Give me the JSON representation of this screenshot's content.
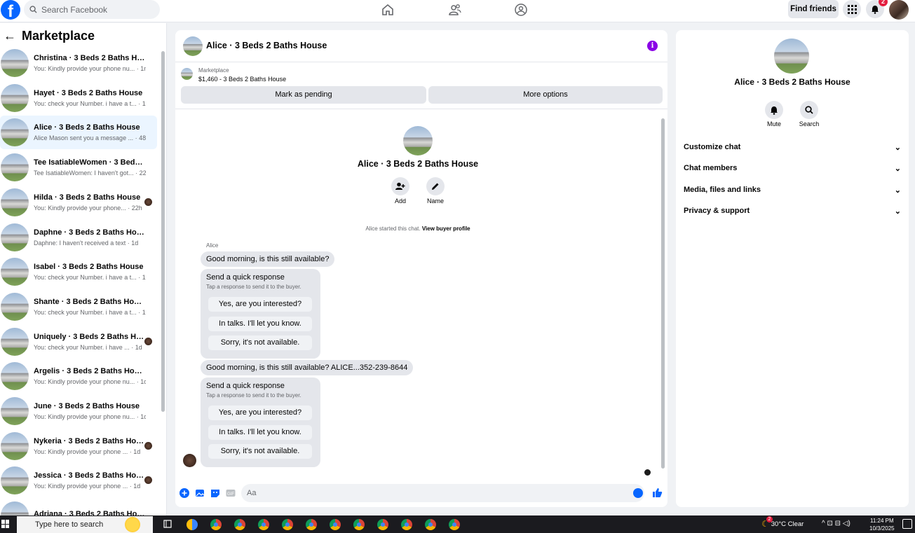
{
  "top": {
    "logo": "f",
    "search_placeholder": "Search Facebook",
    "find_friends": "Find friends",
    "notif_count": "2"
  },
  "sidebar": {
    "title": "Marketplace",
    "items": [
      {
        "name": "Christina · 3 Beds 2 Baths House",
        "preview": "You: Kindly provide your phone nu... · 1m"
      },
      {
        "name": "Hayet · 3 Beds 2 Baths House",
        "preview": "You: check your Number. i have a t... · 1m"
      },
      {
        "name": "Alice · 3 Beds 2 Baths House",
        "preview": "Alice Mason sent you a message ... · 48m"
      },
      {
        "name": "Tee IsatiableWomen · 3 Beds 2 B...",
        "preview": "Tee IsatiableWomen: I haven't got... · 22h"
      },
      {
        "name": "Hilda · 3 Beds 2 Baths House",
        "preview": "You: Kindly provide your phone... · 22h"
      },
      {
        "name": "Daphne · 3 Beds 2 Baths House",
        "preview": "Daphne: I haven't received a text · 1d"
      },
      {
        "name": "Isabel · 3 Beds 2 Baths House",
        "preview": "You: check your Number. i have a t... · 1d"
      },
      {
        "name": "Shante · 3 Beds 2 Baths House",
        "preview": "You: check your Number. i have a t... · 1d"
      },
      {
        "name": "Uniquely · 3 Beds 2 Baths Hou...",
        "preview": "You: check your Number. i have ... · 1d"
      },
      {
        "name": "Argelis · 3 Beds 2 Baths House",
        "preview": "You: Kindly provide your phone nu... · 1d"
      },
      {
        "name": "June · 3 Beds 2 Baths House",
        "preview": "You: Kindly provide your phone nu... · 1d"
      },
      {
        "name": "Nykeria · 3 Beds 2 Baths House",
        "preview": "You: Kindly provide your phone ... · 1d"
      },
      {
        "name": "Jessica · 3 Beds 2 Baths House",
        "preview": "You: Kindly provide your phone ... · 1d"
      },
      {
        "name": "Adriana · 3 Beds 2 Baths House",
        "preview": ""
      }
    ]
  },
  "chat": {
    "title": "Alice · 3 Beds 2 Baths House",
    "info_icon": "i",
    "listing_label": "Marketplace",
    "listing_price": "$1,460 - 3 Beds 2 Baths House",
    "mark_pending": "Mark as pending",
    "more_options": "More options",
    "center_title": "Alice · 3 Beds 2 Baths House",
    "add_label": "Add",
    "name_label": "Name",
    "started_text": "Alice started this chat.",
    "view_profile": "View buyer profile",
    "sender": "Alice",
    "msg1": "Good morning, is this still available?",
    "msg2": "Good morning, is this still available? ALICE...352-239-8644",
    "quick_title": "Send a quick response",
    "quick_sub": "Tap a response to send it to the buyer.",
    "quick_opts": [
      "Yes, are you interested?",
      "In talks. I'll let you know.",
      "Sorry, it's not available."
    ],
    "input_placeholder": "Aa"
  },
  "info": {
    "title": "Alice · 3 Beds 2 Baths House",
    "mute": "Mute",
    "search": "Search",
    "sections": [
      "Customize chat",
      "Chat members",
      "Media, files and links",
      "Privacy & support"
    ]
  },
  "taskbar": {
    "search": "Type here to search",
    "weather": "30°C  Clear",
    "weather_badge": "2",
    "time": "11:24 PM",
    "date": "10/3/2025"
  },
  "colors": {
    "accent": "#0866ff",
    "info": "#8a00e6",
    "badge": "#e41e3f"
  }
}
